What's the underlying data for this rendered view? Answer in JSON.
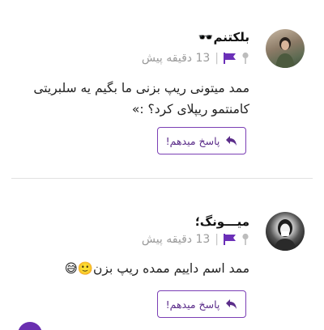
{
  "colors": {
    "accent": "#6b2fb8",
    "muted": "#9a9a9a"
  },
  "comments": [
    {
      "author": "بلکتنم🕶️",
      "time": "13 دقیقه پیش",
      "text": "ممد میتونی ریپ بزنی ما بگیم یه سلبریتی کامنتمو ریپلای کرد؟ :»",
      "reply_label": "پاسخ میدهم!",
      "icons": [
        "pin-icon",
        "flag-icon",
        "reply-icon"
      ]
    },
    {
      "author": "میـــونگ؛",
      "time": "13 دقیقه پیش",
      "text": "ممد اسم داییم ممده ریپ بزن🙂😅",
      "reply_label": "پاسخ میدهم!",
      "icons": [
        "pin-icon",
        "flag-icon",
        "reply-icon"
      ]
    }
  ]
}
